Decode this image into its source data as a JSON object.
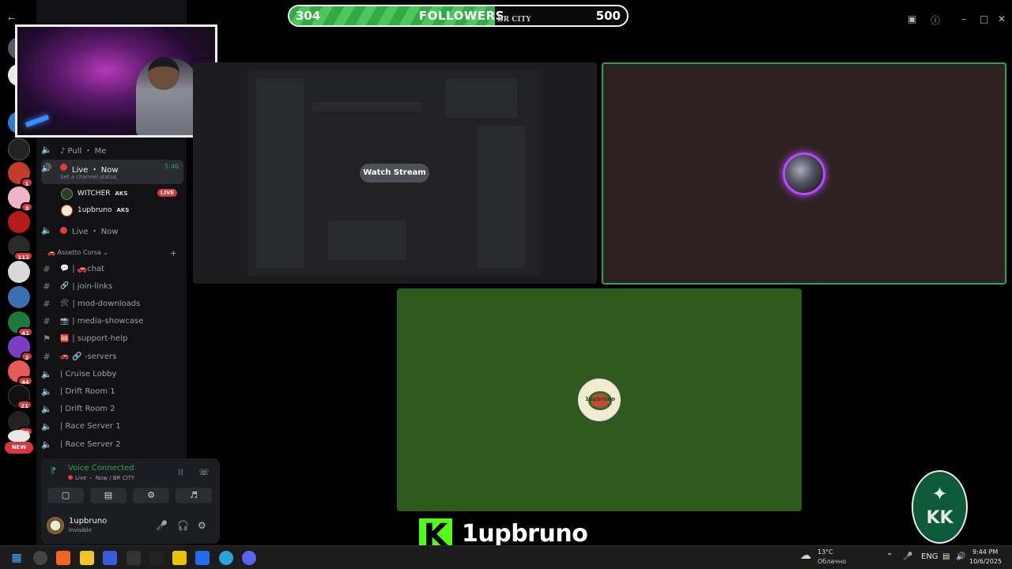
{
  "follower_goal": {
    "current": "304",
    "label": "FOLLOWERS",
    "goal": "500",
    "progress_fraction": 0.608,
    "city": "BR CITY"
  },
  "server_rail": {
    "badges": [
      "1",
      "3",
      "111",
      "41",
      "2",
      "44",
      "21",
      "10"
    ],
    "new_label": "NEW"
  },
  "sidebar": {
    "channels_top": [
      {
        "name": "♪ Pull ・ Me"
      }
    ],
    "active_channel": {
      "name": "Live ・ Now",
      "timer": "5:46",
      "status_hint": "Set a channel status"
    },
    "members": [
      {
        "name": "WITCHER",
        "tag": "AKS",
        "badge": "LIVE"
      },
      {
        "name": "1upbruno",
        "tag": "AKS"
      }
    ],
    "channel_after": {
      "name": "Live ・ Now"
    },
    "category": "Assetto Corsa",
    "channels": [
      {
        "type": "text",
        "emoji": "💬",
        "name": "| 🚗chat"
      },
      {
        "type": "text",
        "emoji": "🔗",
        "name": "| join-links"
      },
      {
        "type": "text",
        "emoji": "🛠",
        "name": "| mod-downloads"
      },
      {
        "type": "text",
        "emoji": "📸",
        "name": "| media-showcase"
      },
      {
        "type": "forum",
        "emoji": "🆘",
        "name": "| support-help"
      },
      {
        "type": "text",
        "emoji": "🚗",
        "name": "🔗 -servers"
      },
      {
        "type": "voice",
        "emoji": "",
        "name": "| Cruise Lobby"
      },
      {
        "type": "voice",
        "emoji": "",
        "name": "| Drift Room 1"
      },
      {
        "type": "voice",
        "emoji": "",
        "name": "| Drift Room 2"
      },
      {
        "type": "voice",
        "emoji": "",
        "name": "| Race Server 1"
      },
      {
        "type": "voice",
        "emoji": "",
        "name": "| Race Server 2"
      }
    ],
    "voice": {
      "title": "Voice Connected",
      "subtitle": "Live ・ Now / BR CITY"
    },
    "user": {
      "name": "1upbruno",
      "status": "Invisible"
    }
  },
  "stage": {
    "watch_label": "Watch Stream",
    "avatar_text": "1upbruno"
  },
  "overlay": {
    "kick_letter": "K",
    "kick_name": "1upbruno",
    "team_mark": "KK"
  },
  "taskbar": {
    "temp": "13°C",
    "condition": "Облачно",
    "lang": "ENG",
    "time": "9:44 PM",
    "date": "10/6/2025"
  },
  "colors": {
    "green": "#23a55a",
    "kick": "#53fc18",
    "live_red": "#da373c"
  }
}
